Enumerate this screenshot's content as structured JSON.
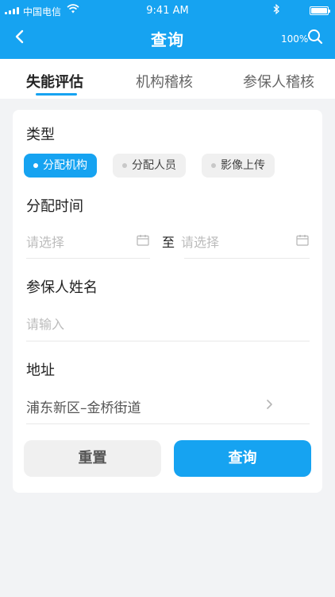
{
  "status_bar": {
    "carrier": "中国电信",
    "time": "9:41 AM"
  },
  "nav": {
    "title": "查询",
    "zoom": "100%"
  },
  "tabs": [
    {
      "label": "失能评估",
      "active": true
    },
    {
      "label": "机构稽核",
      "active": false
    },
    {
      "label": "参保人稽核",
      "active": false
    }
  ],
  "form": {
    "type_label": "类型",
    "type_chips": [
      {
        "label": "分配机构",
        "selected": true
      },
      {
        "label": "分配人员",
        "selected": false
      },
      {
        "label": "影像上传",
        "selected": false
      }
    ],
    "time_label": "分配时间",
    "time_start_placeholder": "请选择",
    "time_separator": "至",
    "time_end_placeholder": "请选择",
    "name_label": "参保人姓名",
    "name_placeholder": "请输入",
    "address_label": "地址",
    "address_value": "浦东新区–金桥街道"
  },
  "buttons": {
    "reset": "重置",
    "query": "查询"
  },
  "colors": {
    "primary": "#16a3f1",
    "background": "#f2f3f5",
    "chip_inactive": "#f0f0f0"
  }
}
